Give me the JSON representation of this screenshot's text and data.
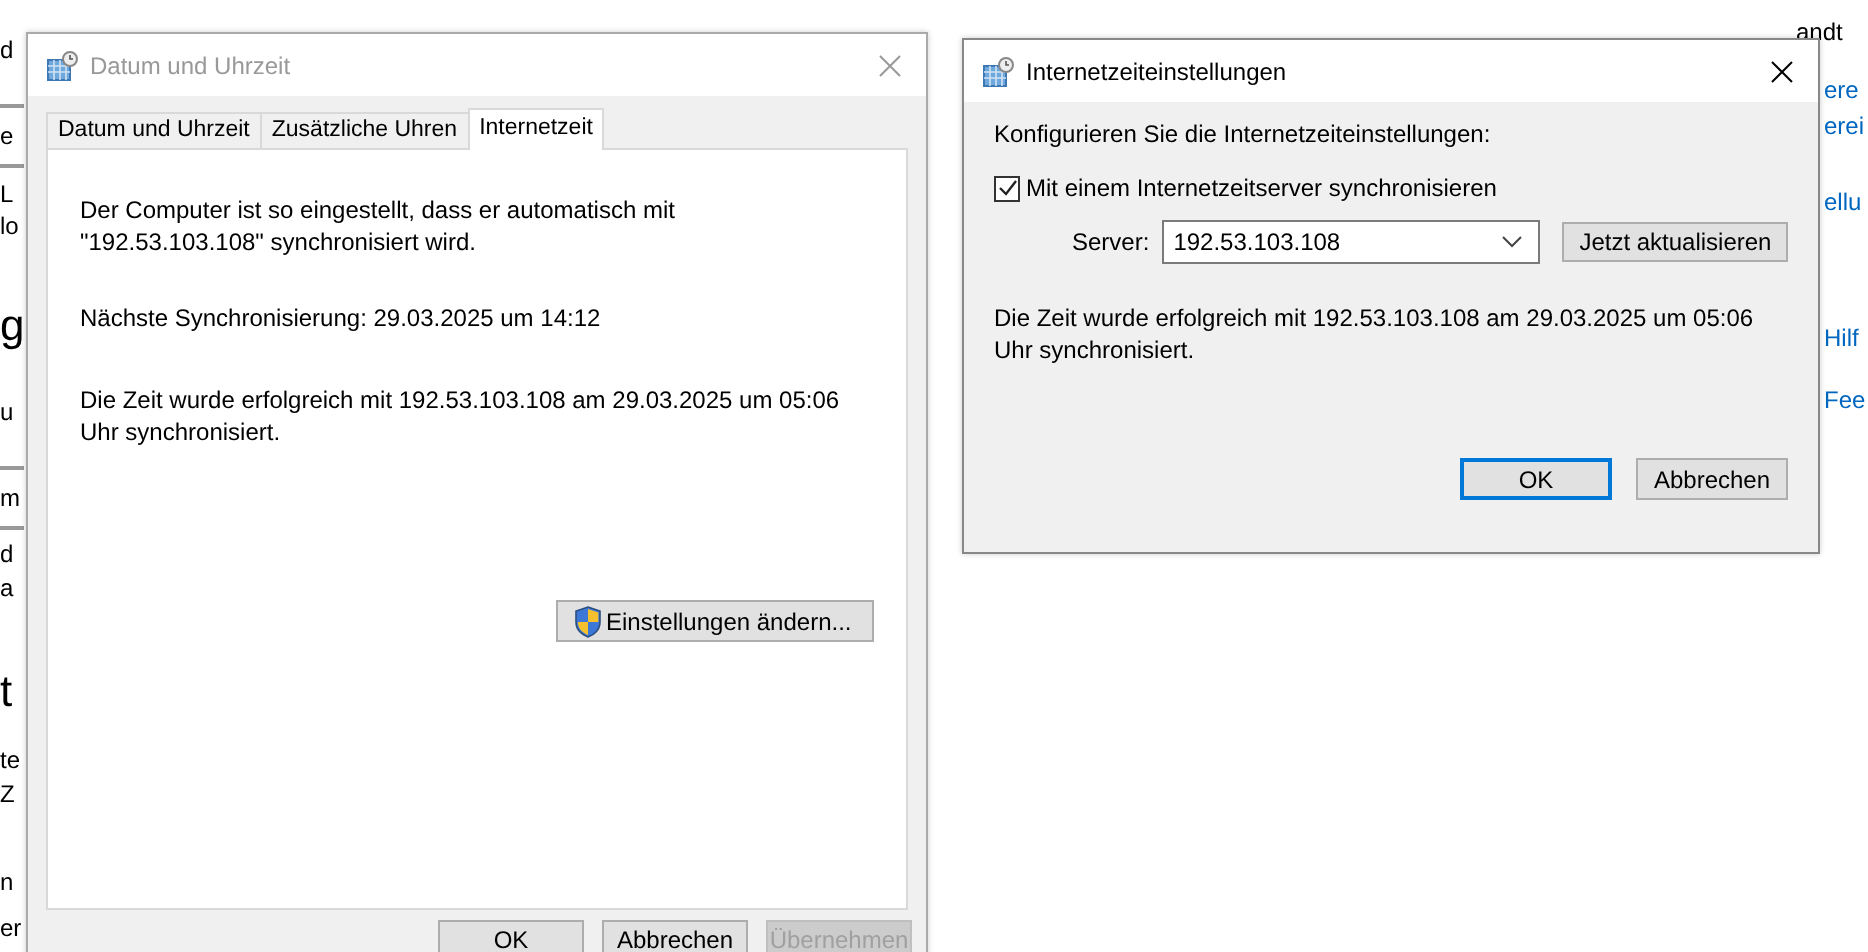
{
  "background_window": {
    "left_fragments": [
      {
        "text": "d",
        "kind": "text"
      },
      {
        "text": "e",
        "kind": "field"
      },
      {
        "text": "L",
        "kind": "text"
      },
      {
        "text": "lo",
        "kind": "text"
      },
      {
        "text": "g",
        "kind": "heading"
      },
      {
        "text": "u",
        "kind": "text"
      },
      {
        "text": "m",
        "kind": "field"
      },
      {
        "text": "d",
        "kind": "text"
      },
      {
        "text": "a",
        "kind": "text"
      },
      {
        "text": "t",
        "kind": "heading"
      },
      {
        "text": "te",
        "kind": "text"
      },
      {
        "text": "Z",
        "kind": "text"
      },
      {
        "text": "n",
        "kind": "text"
      },
      {
        "text": "er",
        "kind": "text"
      }
    ],
    "right_fragments": [
      {
        "text": "andt",
        "kind": "text"
      },
      {
        "text": "ere",
        "kind": "link"
      },
      {
        "text": "erei",
        "kind": "link"
      },
      {
        "text": "ellu",
        "kind": "link"
      },
      {
        "text": "Hilf",
        "kind": "link"
      },
      {
        "text": "Fee",
        "kind": "link"
      }
    ]
  },
  "main_dialog": {
    "title": "Datum und Uhrzeit",
    "active": false,
    "tabs": [
      {
        "label": "Datum und Uhrzeit",
        "selected": false
      },
      {
        "label": "Zusätzliche Uhren",
        "selected": false
      },
      {
        "label": "Internetzeit",
        "selected": true
      }
    ],
    "paragraphs": [
      "Der Computer ist so eingestellt, dass er automatisch mit \"192.53.103.108\" synchronisiert wird.",
      "Nächste Synchronisierung: 29.03.2025 um 14:12",
      "Die Zeit wurde erfolgreich mit 192.53.103.108 am 29.03.2025 um 05:06 Uhr synchronisiert."
    ],
    "change_button": "Einstellungen ändern...",
    "buttons": [
      {
        "label": "OK",
        "disabled": false
      },
      {
        "label": "Abbrechen",
        "disabled": false
      },
      {
        "label": "Übernehmen",
        "disabled": true
      }
    ]
  },
  "settings_dialog": {
    "title": "Internetzeiteinstellungen",
    "active": true,
    "intro": "Konfigurieren Sie die Internetzeiteinstellungen:",
    "sync_checkbox": {
      "label": "Mit einem Internetzeitserver synchronisieren",
      "checked": true
    },
    "server_label": "Server:",
    "server_value": "192.53.103.108",
    "update_button": "Jetzt aktualisieren",
    "status": "Die Zeit wurde erfolgreich mit 192.53.103.108 am 29.03.2025 um 05:06 Uhr synchronisiert.",
    "buttons": [
      {
        "label": "OK",
        "default": true
      },
      {
        "label": "Abbrechen",
        "default": false
      }
    ]
  }
}
